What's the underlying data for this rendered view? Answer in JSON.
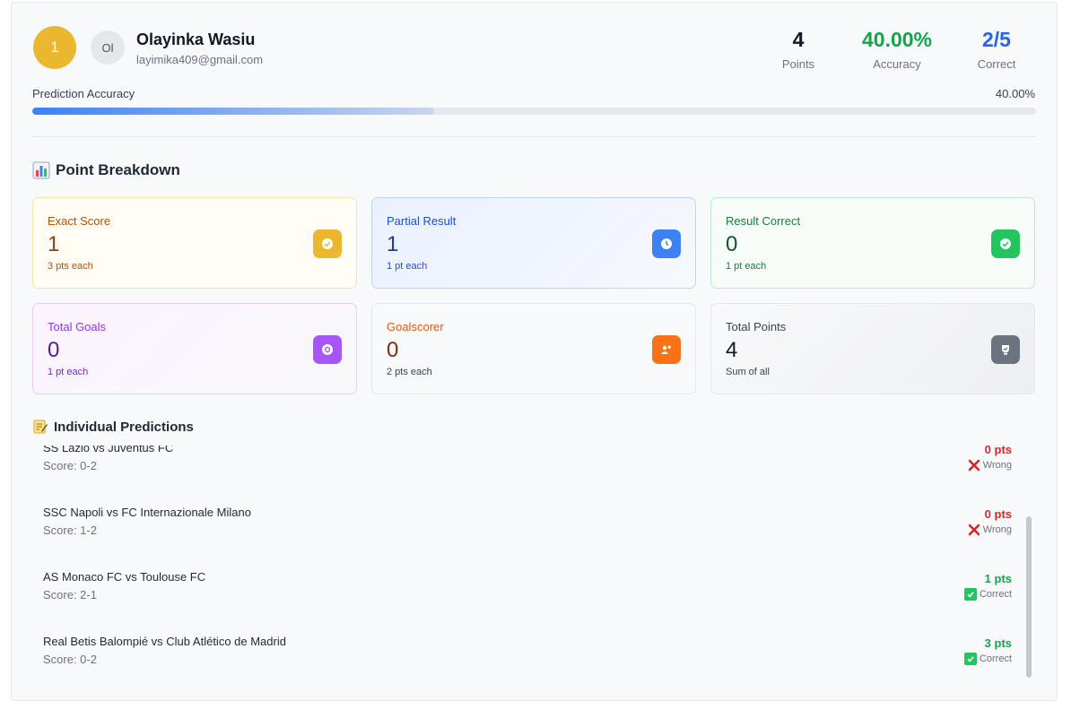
{
  "user": {
    "rank": "1",
    "initials": "Ol",
    "name": "Olayinka Wasiu",
    "email": "layimika409@gmail.com"
  },
  "stats": [
    {
      "value": "4",
      "label": "Points",
      "color": "#111827"
    },
    {
      "value": "40.00%",
      "label": "Accuracy",
      "color": "#16a34a"
    },
    {
      "value": "2/5",
      "label": "Correct",
      "color": "#2563eb"
    }
  ],
  "accuracy": {
    "label": "Prediction Accuracy",
    "value_text": "40.00%",
    "fraction": 0.4
  },
  "breakdown": {
    "title": "Point Breakdown",
    "title_icon": "bar-chart-icon",
    "boxes": [
      {
        "title": "Exact Score",
        "number": "1",
        "sub": "3 pts each",
        "icon": "check-circle-icon",
        "accent": "#ebb72e"
      },
      {
        "title": "Partial Result",
        "number": "1",
        "sub": "1 pt each",
        "icon": "clock-icon",
        "accent": "#3b82f6"
      },
      {
        "title": "Result Correct",
        "number": "0",
        "sub": "1 pt each",
        "icon": "check-circle-icon",
        "accent": "#22c55e"
      },
      {
        "title": "Total Goals",
        "number": "0",
        "sub": "1 pt each",
        "icon": "target-icon",
        "accent": "#a855f7"
      },
      {
        "title": "Goalscorer",
        "number": "0",
        "sub": "2 pts each",
        "icon": "users-icon",
        "accent": "#f97316"
      },
      {
        "title": "Total Points",
        "number": "4",
        "sub": "Sum of all",
        "icon": "trophy-icon",
        "accent": "#6b7280"
      }
    ]
  },
  "predictions": {
    "title": "Individual Predictions",
    "title_icon": "memo-icon",
    "rows": [
      {
        "match": "SS Lazio vs Juventus FC",
        "score": "Score: 0-2",
        "pts": "0 pts",
        "result": "Wrong",
        "correct": false
      },
      {
        "match": "SSC Napoli vs FC Internazionale Milano",
        "score": "Score: 1-2",
        "pts": "0 pts",
        "result": "Wrong",
        "correct": false
      },
      {
        "match": "AS Monaco FC vs Toulouse FC",
        "score": "Score: 2-1",
        "pts": "1 pts",
        "result": "Correct",
        "correct": true
      },
      {
        "match": "Real Betis Balompié vs Club Atlético de Madrid",
        "score": "Score: 0-2",
        "pts": "3 pts",
        "result": "Correct",
        "correct": true
      }
    ]
  }
}
